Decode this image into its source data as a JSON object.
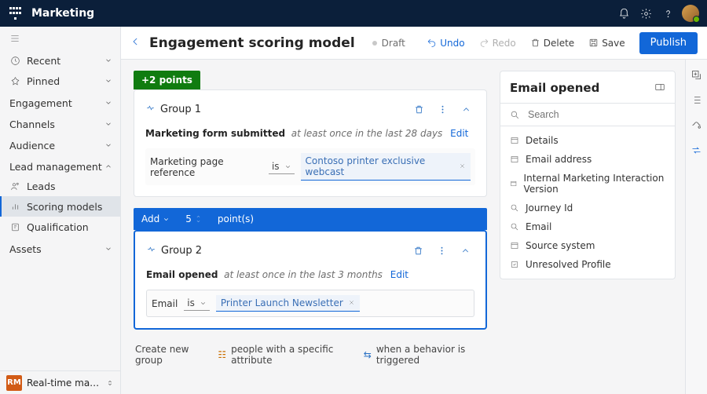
{
  "topbar": {
    "app_name": "Marketing"
  },
  "nav": {
    "recent": "Recent",
    "pinned": "Pinned",
    "sections": {
      "engagement": "Engagement",
      "channels": "Channels",
      "audience": "Audience",
      "lead_mgmt": "Lead management",
      "assets": "Assets"
    },
    "lead_items": {
      "leads": "Leads",
      "scoring": "Scoring models",
      "qualification": "Qualification"
    },
    "footer_badge": "RM",
    "footer_label": "Real-time marketi…"
  },
  "cmdbar": {
    "title": "Engagement scoring model",
    "status": "Draft",
    "undo": "Undo",
    "redo": "Redo",
    "delete": "Delete",
    "save": "Save",
    "publish": "Publish"
  },
  "canvas": {
    "points_badge": "+2 points",
    "group1": {
      "name": "Group 1",
      "cond_name": "Marketing form submitted",
      "cond_scope": "at least once in the last 28 days",
      "edit": "Edit",
      "field_label": "Marketing page reference",
      "op": "is",
      "token": "Contoso printer exclusive webcast"
    },
    "addpill": {
      "add": "Add",
      "num": "5",
      "points": "point(s)"
    },
    "group2": {
      "name": "Group 2",
      "cond_name": "Email opened",
      "cond_scope": "at least once in the last 3 months",
      "edit": "Edit",
      "field_label": "Email",
      "op": "is",
      "token": "Printer Launch Newsletter"
    },
    "create": {
      "label": "Create new group",
      "opt1": "people with a specific attribute",
      "opt2": "when a behavior is triggered"
    }
  },
  "panel": {
    "title": "Email opened",
    "search_placeholder": "Search",
    "items": {
      "details": "Details",
      "email_address": "Email address",
      "imiv": "Internal Marketing Interaction Version",
      "journey": "Journey Id",
      "email": "Email",
      "source": "Source system",
      "unresolved": "Unresolved Profile"
    }
  }
}
